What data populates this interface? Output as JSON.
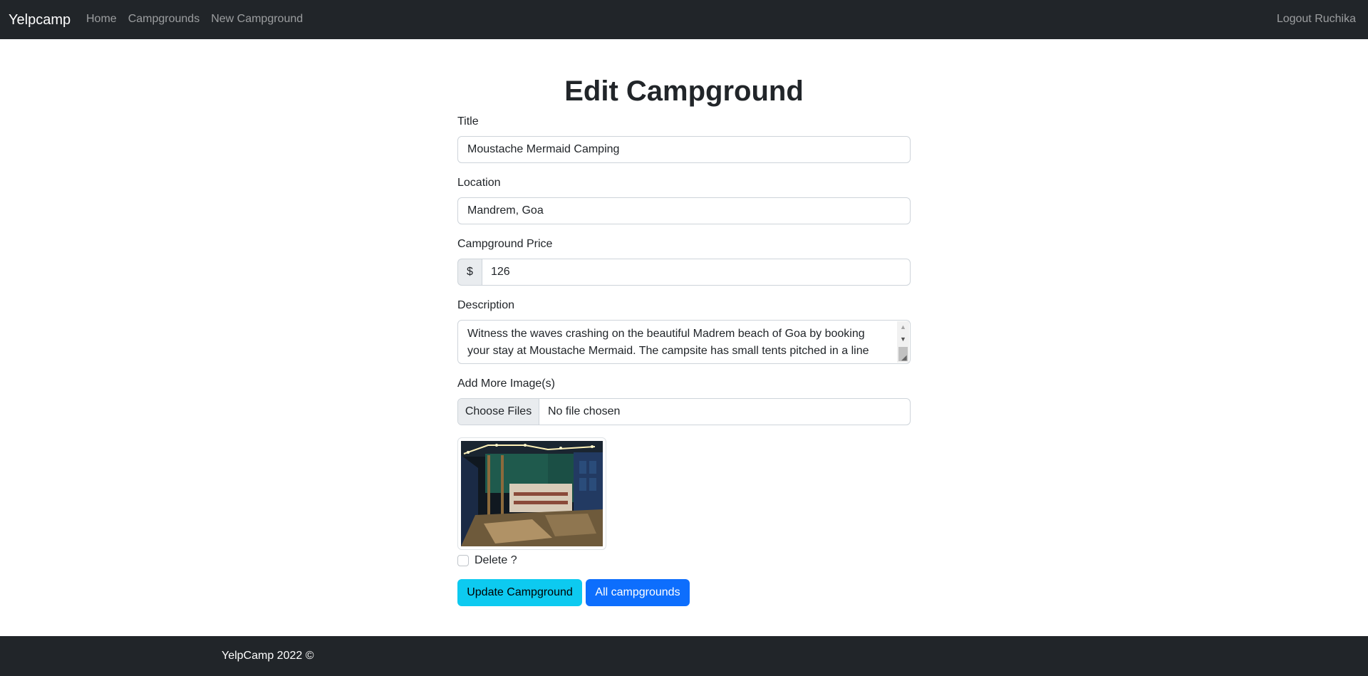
{
  "navbar": {
    "brand": "Yelpcamp",
    "links": [
      {
        "label": "Home"
      },
      {
        "label": "Campgrounds"
      },
      {
        "label": "New Campground"
      }
    ],
    "logout": "Logout Ruchika"
  },
  "form": {
    "title": "Edit Campground",
    "title_label": "Title",
    "title_value": "Moustache Mermaid Camping",
    "location_label": "Location",
    "location_value": "Mandrem, Goa",
    "price_label": "Campground Price",
    "price_prefix": "$",
    "price_value": "126",
    "description_label": "Description",
    "description_value": "Witness the waves crashing on the beautiful Madrem beach of Goa by booking your stay at Moustache Mermaid. The campsite has small tents pitched in a line",
    "images_label": "Add More Image(s)",
    "choose_files": "Choose Files",
    "file_status": "No file chosen",
    "delete_label": "Delete ?",
    "update_button": "Update Campground",
    "all_button": "All campgrounds"
  },
  "footer": {
    "text": "YelpCamp 2022 ©"
  },
  "colors": {
    "navbar_bg": "#212529",
    "info": "#0dcaf0",
    "primary": "#0d6efd"
  }
}
